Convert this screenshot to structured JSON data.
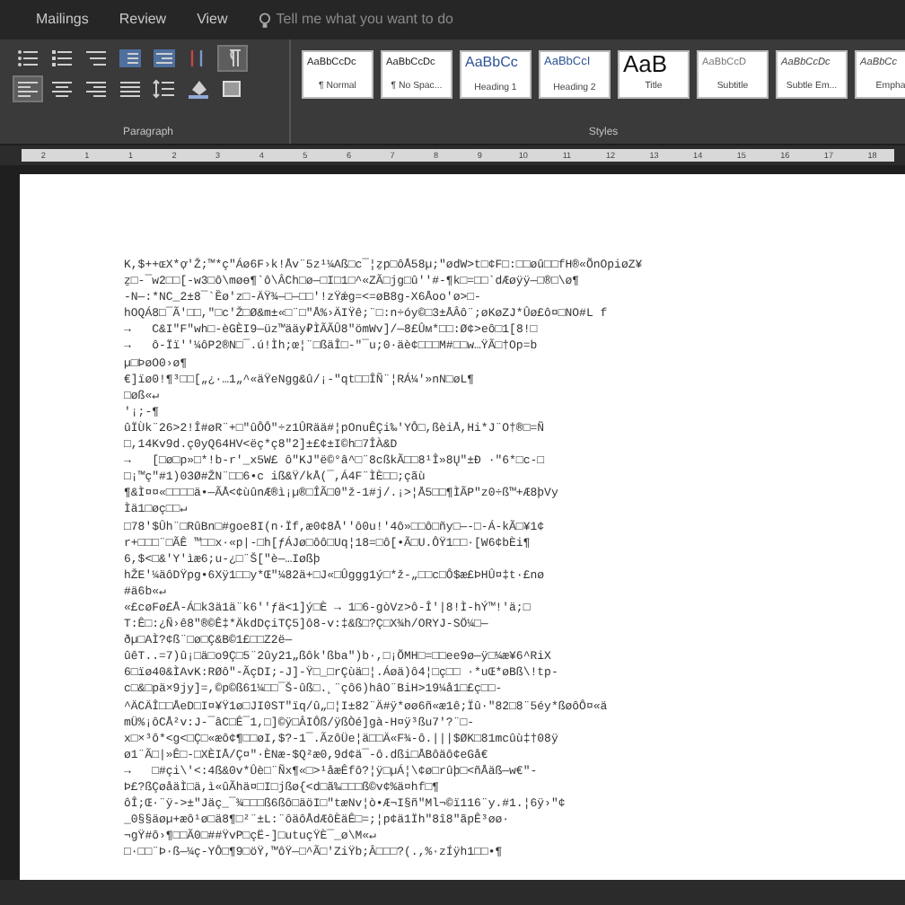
{
  "tabs": [
    {
      "label": "Mailings"
    },
    {
      "label": "Review"
    },
    {
      "label": "View"
    }
  ],
  "tell_me": {
    "placeholder": "Tell me what you want to do"
  },
  "paragraph_group": {
    "label": "Paragraph",
    "show_marks_on": true,
    "align_left_on": true
  },
  "styles_group": {
    "label": "Styles",
    "styles": [
      {
        "preview": "AaBbCcDc",
        "name": "¶ Normal",
        "kind": "body"
      },
      {
        "preview": "AaBbCcDc",
        "name": "¶ No Spac...",
        "kind": "body"
      },
      {
        "preview": "AaBbCc",
        "name": "Heading 1",
        "kind": "heading1"
      },
      {
        "preview": "AaBbCcI",
        "name": "Heading 2",
        "kind": "heading2"
      },
      {
        "preview": "AaB",
        "name": "Title",
        "kind": "title"
      },
      {
        "preview": "AaBbCcD",
        "name": "Subtitle",
        "kind": "subtitle"
      },
      {
        "preview": "AaBbCcDc",
        "name": "Subtle Em...",
        "kind": "emphasis"
      },
      {
        "preview": "AaBbCc",
        "name": "Empha",
        "kind": "emphasis"
      }
    ]
  },
  "ruler": {
    "marks": [
      "2",
      "1",
      "1",
      "2",
      "3",
      "4",
      "5",
      "6",
      "7",
      "8",
      "9",
      "10",
      "11",
      "12",
      "13",
      "14",
      "15",
      "16",
      "17",
      "18"
    ]
  },
  "document": {
    "lines": [
      "K,$++ɶX*ợ'Ž;™*ç\"Áø6F›k!Åv¨5z¹¼Aß□c¯¦ẕp□ôÅ58µ;\"ødW>t□¢F□:□□øû□□fH®«ÕnOpiøZ¥",
      "ẕ□-¯w2□□[-w3□ô\\møɵ¶`ô\\ÂCh□ø—□I□1□^«ZÃ□jg□û''#-¶k□=□□`dÆøÿÿ—□®□\\ø¶",
      "-N—:*NC_2±8¯`Ȅø'z□-ÄŸ¾—□—□□'!zŸǽg=<=øB8g-X6Åoo'ø>□-",
      "hOQÁ8□¯Ã'□□,\"□c'Ž□Ø&m±«□¨□\"Å%›ÄIŸê;¨□:n÷óy©□3±ÅÂô¨;øKøZJ*Ûø£ô¤□NO#L f",
      "→   C&I\"F\"wh□-èGÈI9—üz™ääy₽ÌÃÃÛ8\"ömWv]/—8£Ûм*□□:Ø¢>eô□1[8!□",
      "→   ô-Ïï''¼ôP2®N□¯.ú!Ìh;œ¦¨□ßäÎ□-\"¯u;0·äè¢□□□M#□□w…ŸÃ□†Op=b",
      "µ□ÞøO0›ø¶",
      "€]ïø0!¶³□□[„¿·…1„^«äŸeNgg&û/¡-\"qt□□ÎÑ¨¦RÁ¼'»nN□øL¶",
      "□øß«↵",
      "'¡;-¶",
      "ûÏÙk¨26>2!Î#øR¨+□\"ûÔÔ\"÷z1ÛRää#¦pOnuÊÇi‰'YÔ□,ßèiÅ,Hi*J¨O†®□=Ñ",
      "□,14Kv9d.ç0yQ64HV<ëç*ç8\"2]±£¢±I©h□7ÎÀ&D",
      "→   [□ø□p»□*!b-r'_x5W£ ô\"KJ\"ë©°â^□¨8cßkÃ□□8¹Î»8Ų\"±Ð ·\"6*□c-□",
      "□¡™ç\"#1)03Ø#ŽN¨□□6•c iß&Ÿ/kÅ(¯,Á4F¨ÌÈ□□;çãù",
      "¶&Ì¤¤«□□□□ä•—ÃÅ<¢ùûnÆ®ì¡µ®□ÎÃ□0\"ž-1#j/.¡>¦Å5□□¶ÌÃP\"z0÷ß™+Æ8þVy",
      "Ìä1□øç□□↵",
      "□78'$Ûh¨□RûBn□#goe8I(n·Ïf,æ0¢8Å''ô0u!'4ô»□□ô□ñy□—-□-Á-kÃ□¥1¢",
      "r+□□□¨□ÃÊ ™□□x·«p|-□h[ƒÁJø□ôô□Uq¦18=□ô[•Ã□U.ÔŸ1□□·[W6¢bÈi¶",
      "6,$<□&'Y'ìæ6;u-¿□¨Š[\"è—…Iøßþ",
      "hŽE'¼äôDŸpg•6Xÿ1□□y*Œ\"¼82ä+□J«□Ûggg1ý□*ž-„□□c□Ô$æ£ÞHÛ¤‡t·£nø",
      "#ä6b«↵",
      "«£cøFø£Å-Á□k3ä1ä¨k6''ƒä<1]ý□È → 1□6-gòVz>ô-Î'|8!Ì-hÝ™!'ä;□",
      "T:Ê□:¿Ñ›ê8\"®©Ê‡*ÄkdDçiTÇ5]ô8-v:‡&ß□?Ç□X¾h/ORYJ-SÖ¼□—",
      "ðµ□AÌ?¢ß¨□ø□Ç&B©1£□□Z2ë—",
      "ûêT..=7)û¡□ä□o9Ç□5¨2ûy21„ßôk'ßba\")b·,□¡ÕMH□=□□ee9ø—ÿ□¼æ¥6^RiX",
      "6□ïø40&ÌAvK:RØô\"-ÃçDI;-J]-Ÿ□_□rÇùä□¦.Áøä)ô4¦□ç□□ ·*uŒ*øBß\\!tp-",
      "c□&□pä×9jy]=,©p©ß61¼□□¯Š-ûß□.¸¨çô6)hâO¨BiH>19¼å1□£ç□□-",
      "^ÄCÄÎ□□ÅeD□I¤¥Ÿ1ø□JI0ST\"ïq/û„□¦I±82¨Ä#ÿ*øø6ñ«æ1ê;Ϊû·\"82□8¨5éy*ßøôÔ¤«ä",
      "mÜ%¡ôCÅ²v:J-¯âC□Ê¯1,□]©ÿ□ÂIÔß/ÿßÒé]gà-H¤ÿ³ßu7'?¨□-",
      "x□×³ô*<g<□Ç□«æô¢¶□□øI,$?-1¯.ÃzôÜe¦ä□□Ä«F¾-ô.|||$ØK□81mcûù‡†08ÿ",
      "ø1¨Ã□|»Ê□-□XÈIÅ/Ç¤\"·ÈNæ-$Q²æ0,9d¢ä¯-ô.dßi□ÅBôäô¢eGå€",
      "→   □#çi\\'<:4ß&0v*Ûè□¨Ñx¶«□>¹åæÊfô?¦ÿ□µÁ¦\\¢ø□rûþ□<ñÅäß—w€\"-",
      "Þ£?ßÇøåäÌ□ä,ì«ûÃhä¤□I□jßø{<d□ã‰□□□ß©v¢%ä¤hf□¶",
      "ôÎ;Œ·¨ÿ->±\"Jäç_¯¾□□□ß6ßô□äöI□\"tæNv¦ò•Æ¬I§ñ\"Ml¬©ï116¨y.#1.¦6ÿ›\"¢",
      "_0§§äøµ+æô¹ø□ä8¶□²¨±L:¨ôäôÅdÆôÈäÊ□=;¦p¢ä1Ïh\"8î8\"ãpÊ³øø·",
      "¬gŸ#ô›¶□□Ã0□##ŸvP□çË-]□utuçŸÈ¯_ø\\M«↵",
      "□·□□¨Þ·ß—¼ç-YÔ□¶9□öŸ,™ôŸ—□^Ã□'ZiŸb;Â□□□?(.,%·zÍÿh1□□•¶"
    ]
  }
}
